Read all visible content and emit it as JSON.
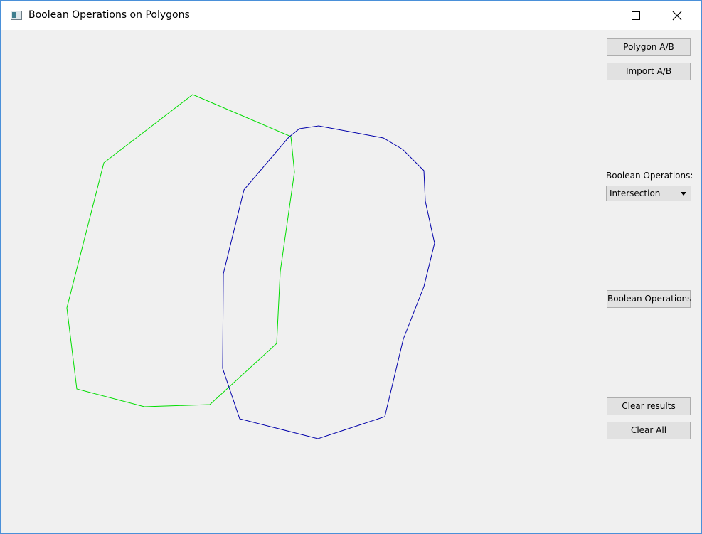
{
  "window": {
    "title": "Boolean Operations on Polygons"
  },
  "sidebar": {
    "polygon_ab_label": "Polygon A/B",
    "import_ab_label": "Import A/B",
    "operations_label": "Boolean Operations:",
    "operation_selected": "Intersection",
    "run_button_label": "Boolean Operations",
    "clear_results_label": "Clear results",
    "clear_all_label": "Clear All"
  },
  "polygons": {
    "a_color": "#00dd00",
    "b_color": "#0000aa"
  },
  "icons": {
    "minimize": "minimize-icon",
    "maximize": "maximize-icon",
    "close": "close-icon",
    "app": "app-window-icon",
    "dropdown": "chevron-down-icon"
  }
}
